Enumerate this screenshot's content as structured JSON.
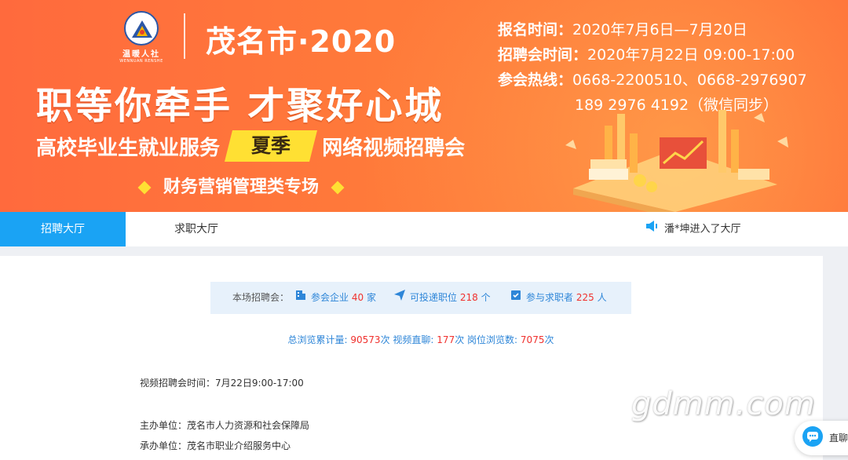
{
  "banner": {
    "logo_cn": "温暖人社",
    "logo_en": "WENNUAN RENSHE",
    "city_title": "茂名市·2020",
    "slogan": "职等你牵手 才聚好心城",
    "sub_left": "高校毕业生就业服务",
    "season": "夏季",
    "sub_right": "网络视频招聘会",
    "special": "财务营销管理类专场",
    "reg_label": "报名时间：",
    "reg_value": "2020年7月6日—7月20日",
    "fair_label": "招聘会时间：",
    "fair_value": "2020年7月22日 09:00-17:00",
    "hotline_label": "参会热线：",
    "hotline_value": "0668-2200510、0668-2976907",
    "hotline_value2": "189 2976 4192（微信同步）"
  },
  "tabs": {
    "active": "招聘大厅",
    "second": "求职大厅"
  },
  "notice": {
    "text": "潘*坤进入了大厅"
  },
  "stats": {
    "label": "本场招聘会：",
    "companies_label": "参会企业",
    "companies_value": "40",
    "companies_unit": "家",
    "positions_label": "可投递职位",
    "positions_value": "218",
    "positions_unit": "个",
    "seekers_label": "参与求职者",
    "seekers_value": "225",
    "seekers_unit": "人"
  },
  "views": {
    "total_label": "总浏览累计量:",
    "total_value": "90573",
    "total_unit": "次",
    "video_label": "视频直聊:",
    "video_value": "177",
    "video_unit": "次",
    "job_label": "岗位浏览数:",
    "job_value": "7075",
    "job_unit": "次"
  },
  "info": {
    "time": "视频招聘会时间：7月22日9:00-17:00",
    "host": "主办单位：茂名市人力资源和社会保障局",
    "organizer": "承办单位：茂名市职业介绍服务中心"
  },
  "watermark": "gdmm.com",
  "chat": {
    "label": "直聊"
  },
  "colors": {
    "banner": "#ff6a3d",
    "tab_active": "#1aa3f4",
    "highlight": "#ffe033",
    "number_red": "#f0312e",
    "link_blue": "#2e86d8"
  }
}
